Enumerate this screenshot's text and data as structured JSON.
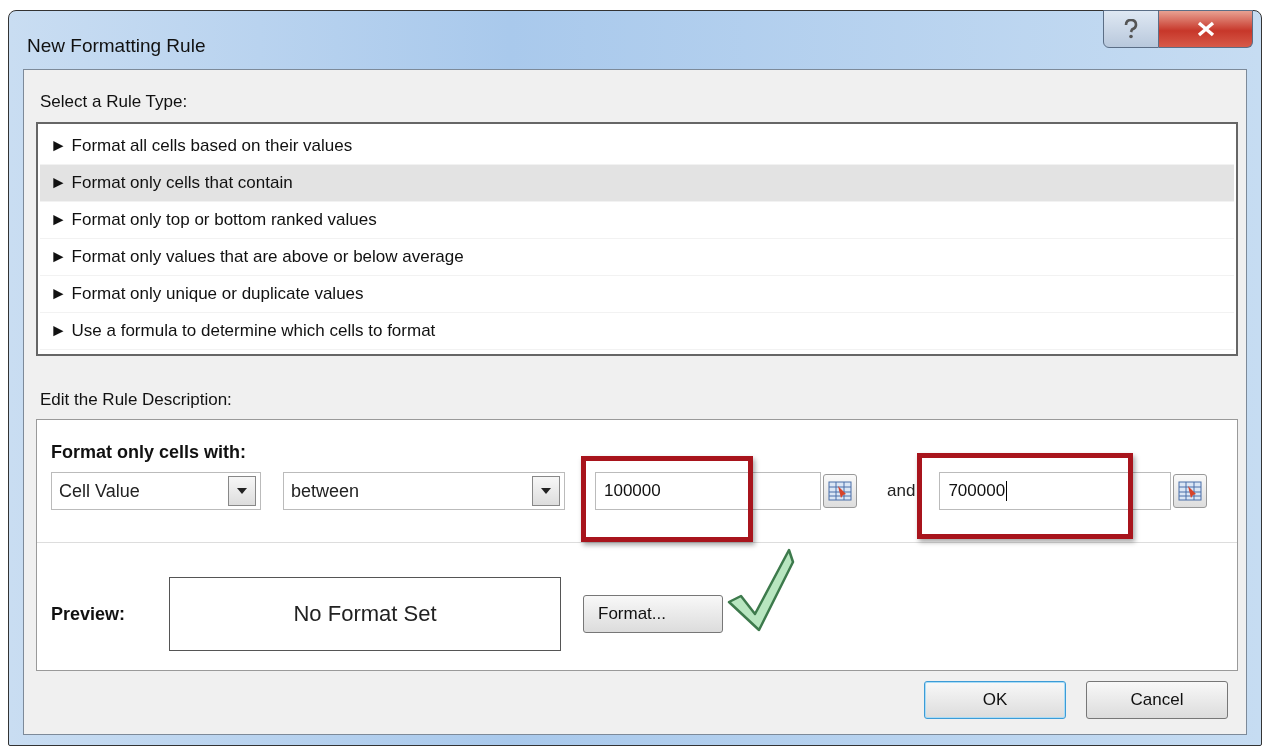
{
  "window": {
    "title": "New Formatting Rule"
  },
  "rule_type_label": "Select a Rule Type:",
  "rule_types": [
    {
      "label": "► Format all cells based on their values",
      "selected": false
    },
    {
      "label": "► Format only cells that contain",
      "selected": true
    },
    {
      "label": "► Format only top or bottom ranked values",
      "selected": false
    },
    {
      "label": "► Format only values that are above or below average",
      "selected": false
    },
    {
      "label": "► Format only unique or duplicate values",
      "selected": false
    },
    {
      "label": "► Use a formula to determine which cells to format",
      "selected": false
    }
  ],
  "description_label": "Edit the Rule Description:",
  "condition": {
    "heading": "Format only cells with:",
    "field": "Cell Value",
    "operator": "between",
    "value_1": "100000",
    "joiner": "and",
    "value_2": "700000"
  },
  "preview": {
    "label": "Preview:",
    "text": "No Format Set"
  },
  "format_button": "Format...",
  "buttons": [
    "OK",
    "Cancel"
  ]
}
